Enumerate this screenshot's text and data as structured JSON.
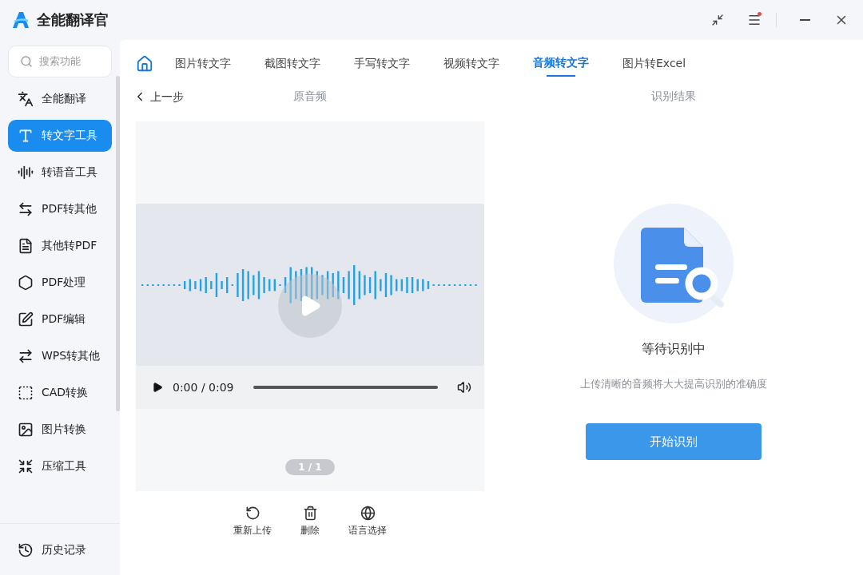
{
  "window": {
    "title": "全能翻译官",
    "menu_notification": true
  },
  "sidebar": {
    "search": {
      "placeholder": "搜索功能"
    },
    "items": [
      {
        "label": "全能翻译",
        "selected": false
      },
      {
        "label": "转文字工具",
        "selected": true
      },
      {
        "label": "转语音工具",
        "selected": false
      },
      {
        "label": "PDF转其他",
        "selected": false
      },
      {
        "label": "其他转PDF",
        "selected": false
      },
      {
        "label": "PDF处理",
        "selected": false
      },
      {
        "label": "PDF编辑",
        "selected": false
      },
      {
        "label": "WPS转其他",
        "selected": false
      },
      {
        "label": "CAD转换",
        "selected": false
      },
      {
        "label": "图片转换",
        "selected": false
      },
      {
        "label": "压缩工具",
        "selected": false
      }
    ],
    "footer_item": {
      "label": "历史记录"
    }
  },
  "tabs": [
    {
      "label": "图片转文字",
      "selected": false
    },
    {
      "label": "截图转文字",
      "selected": false
    },
    {
      "label": "手写转文字",
      "selected": false
    },
    {
      "label": "视频转文字",
      "selected": false
    },
    {
      "label": "音频转文字",
      "selected": true
    },
    {
      "label": "图片转Excel",
      "selected": false
    }
  ],
  "back": "上一步",
  "source": {
    "heading": "原音频",
    "player_time": "0:00 / 0:09",
    "page": "1 / 1",
    "actions": [
      {
        "label": "重新上传"
      },
      {
        "label": "删除"
      },
      {
        "label": "语言选择"
      }
    ]
  },
  "result": {
    "heading": "识别结果",
    "status": "等待识别中",
    "hint": "上传清晰的音频将大大提高识别的准确度",
    "button": "开始识别"
  }
}
